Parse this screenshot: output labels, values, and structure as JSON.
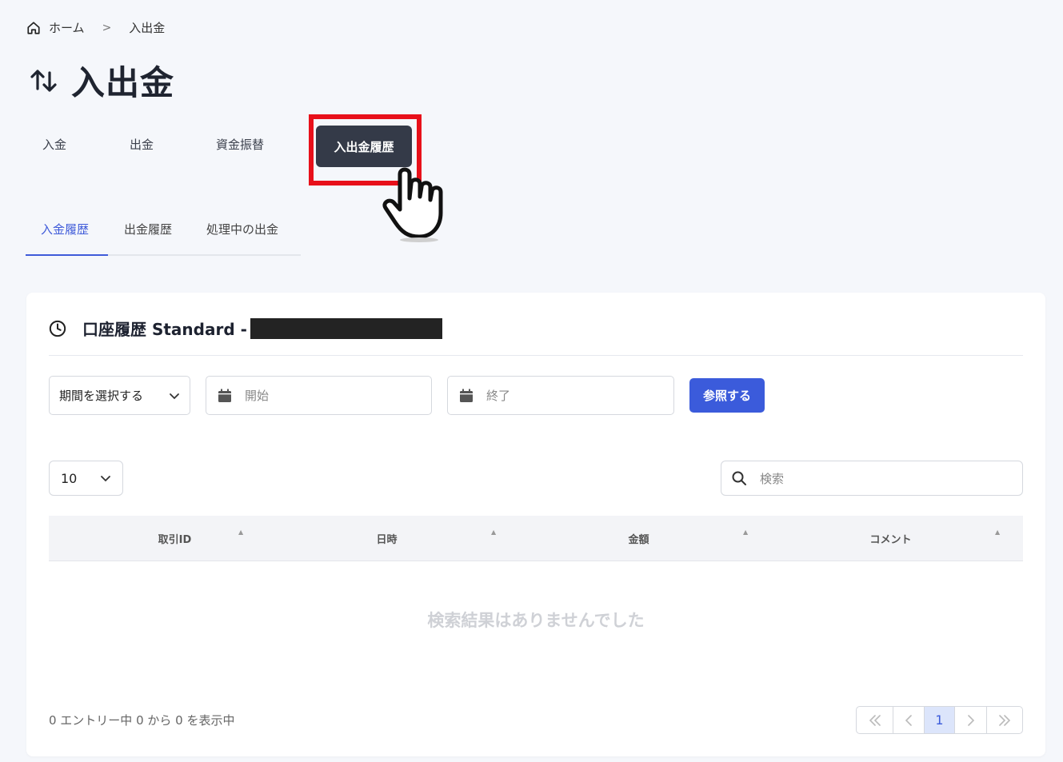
{
  "breadcrumb": {
    "home": "ホーム",
    "current": "入出金"
  },
  "page": {
    "title": "入出金"
  },
  "main_tabs": [
    {
      "label": "入金"
    },
    {
      "label": "出金"
    },
    {
      "label": "資金振替"
    },
    {
      "label": "入出金履歴",
      "active": true
    }
  ],
  "sub_tabs": [
    {
      "label": "入金履歴",
      "active": true
    },
    {
      "label": "出金履歴"
    },
    {
      "label": "処理中の出金"
    }
  ],
  "card": {
    "title": "口座履歴 Standard -",
    "period_select": "期間を選択する",
    "start_placeholder": "開始",
    "end_placeholder": "終了",
    "ref_button": "参照する",
    "page_size": "10",
    "search_placeholder": "検索",
    "columns": [
      "取引ID",
      "日時",
      "金額",
      "コメント"
    ],
    "empty_message": "検索結果はありませんでした",
    "entry_info": "0 エントリー中 0 から 0 を表示中",
    "pagination": {
      "current_page": "1"
    }
  },
  "colors": {
    "accent": "#3b5bdb",
    "highlight": "#e8101a",
    "active_tab": "#343a48"
  }
}
